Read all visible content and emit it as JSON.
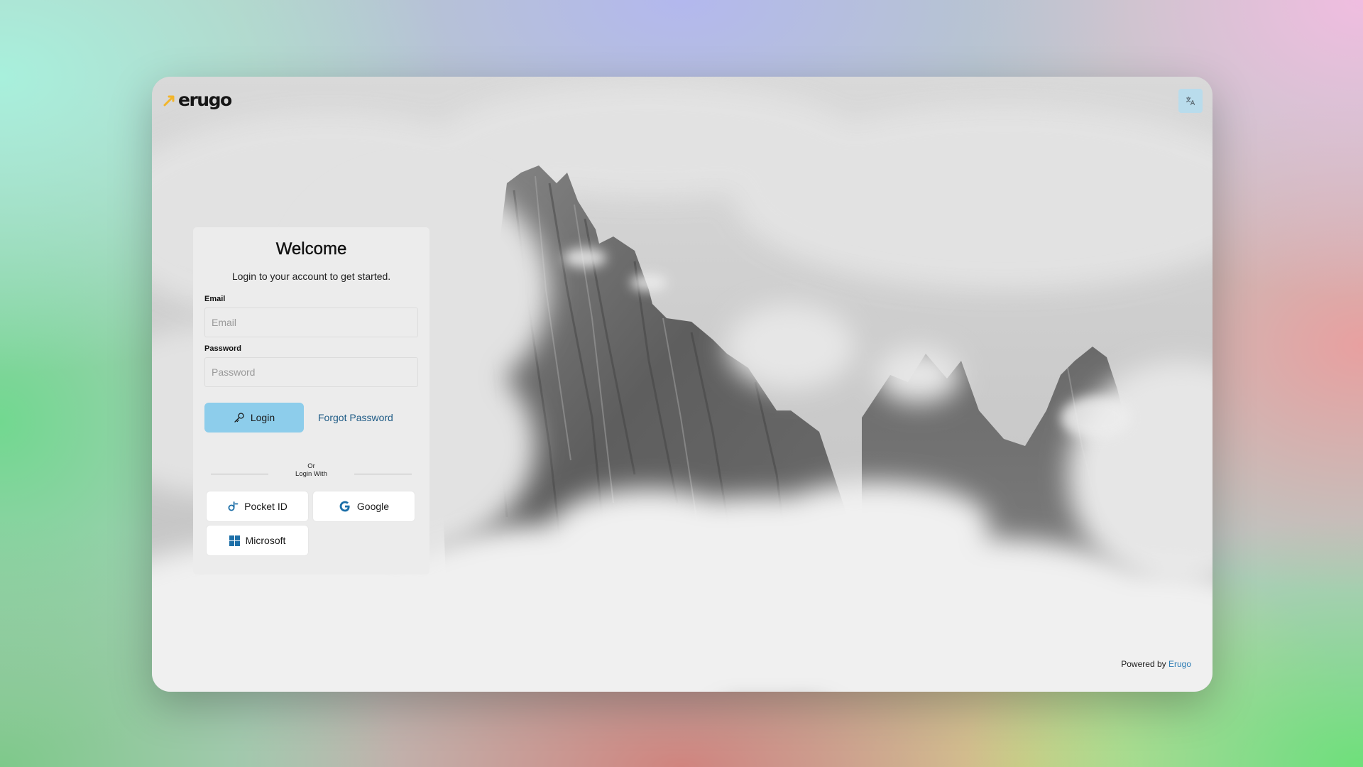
{
  "brand": {
    "name": "erugo",
    "accent_color": "#f2b52a"
  },
  "header": {
    "language_button_icon": "translate-icon"
  },
  "login": {
    "title": "Welcome",
    "subtitle": "Login to your account to get started.",
    "email_label": "Email",
    "email_placeholder": "Email",
    "email_value": "",
    "password_label": "Password",
    "password_placeholder": "Password",
    "password_value": "",
    "login_button_label": "Login",
    "login_button_icon": "key-icon",
    "forgot_password_label": "Forgot Password",
    "divider_line1": "Or",
    "divider_line2": "Login With",
    "button_color": "#8dcdeb"
  },
  "sso": {
    "providers": [
      {
        "label": "Pocket ID",
        "icon": "pocket-id-icon"
      },
      {
        "label": "Google",
        "icon": "google-icon"
      },
      {
        "label": "Microsoft",
        "icon": "microsoft-icon"
      }
    ]
  },
  "footer": {
    "powered_by_text": "Powered by",
    "powered_by_link": "Erugo",
    "link_color": "#2b7bb3"
  }
}
